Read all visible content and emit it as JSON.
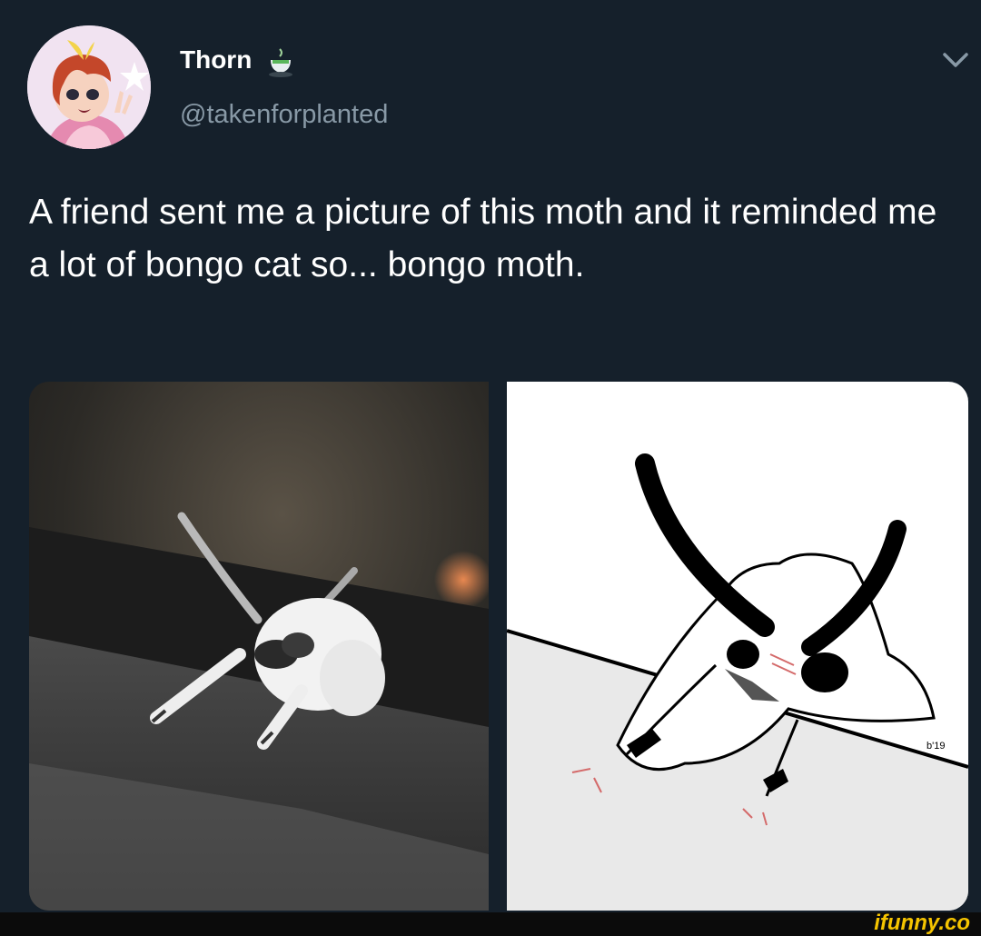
{
  "tweet": {
    "display_name": "Thorn",
    "name_emoji": "teacup-icon",
    "handle": "@takenforplanted",
    "text": "A friend sent me a picture of this moth and it reminded me a lot of bongo cat so... bongo moth.",
    "avatar": "avatar-illustration",
    "menu_icon": "chevron-down-icon"
  },
  "media": {
    "left": "moth-photo",
    "right": "bongo-moth-drawing",
    "drawing_signature": "b'19"
  },
  "watermark": {
    "text": "ifunny.co",
    "color": "#f5c400"
  },
  "colors": {
    "background": "#15202b",
    "text_primary": "#ffffff",
    "text_secondary": "#8899a6"
  }
}
